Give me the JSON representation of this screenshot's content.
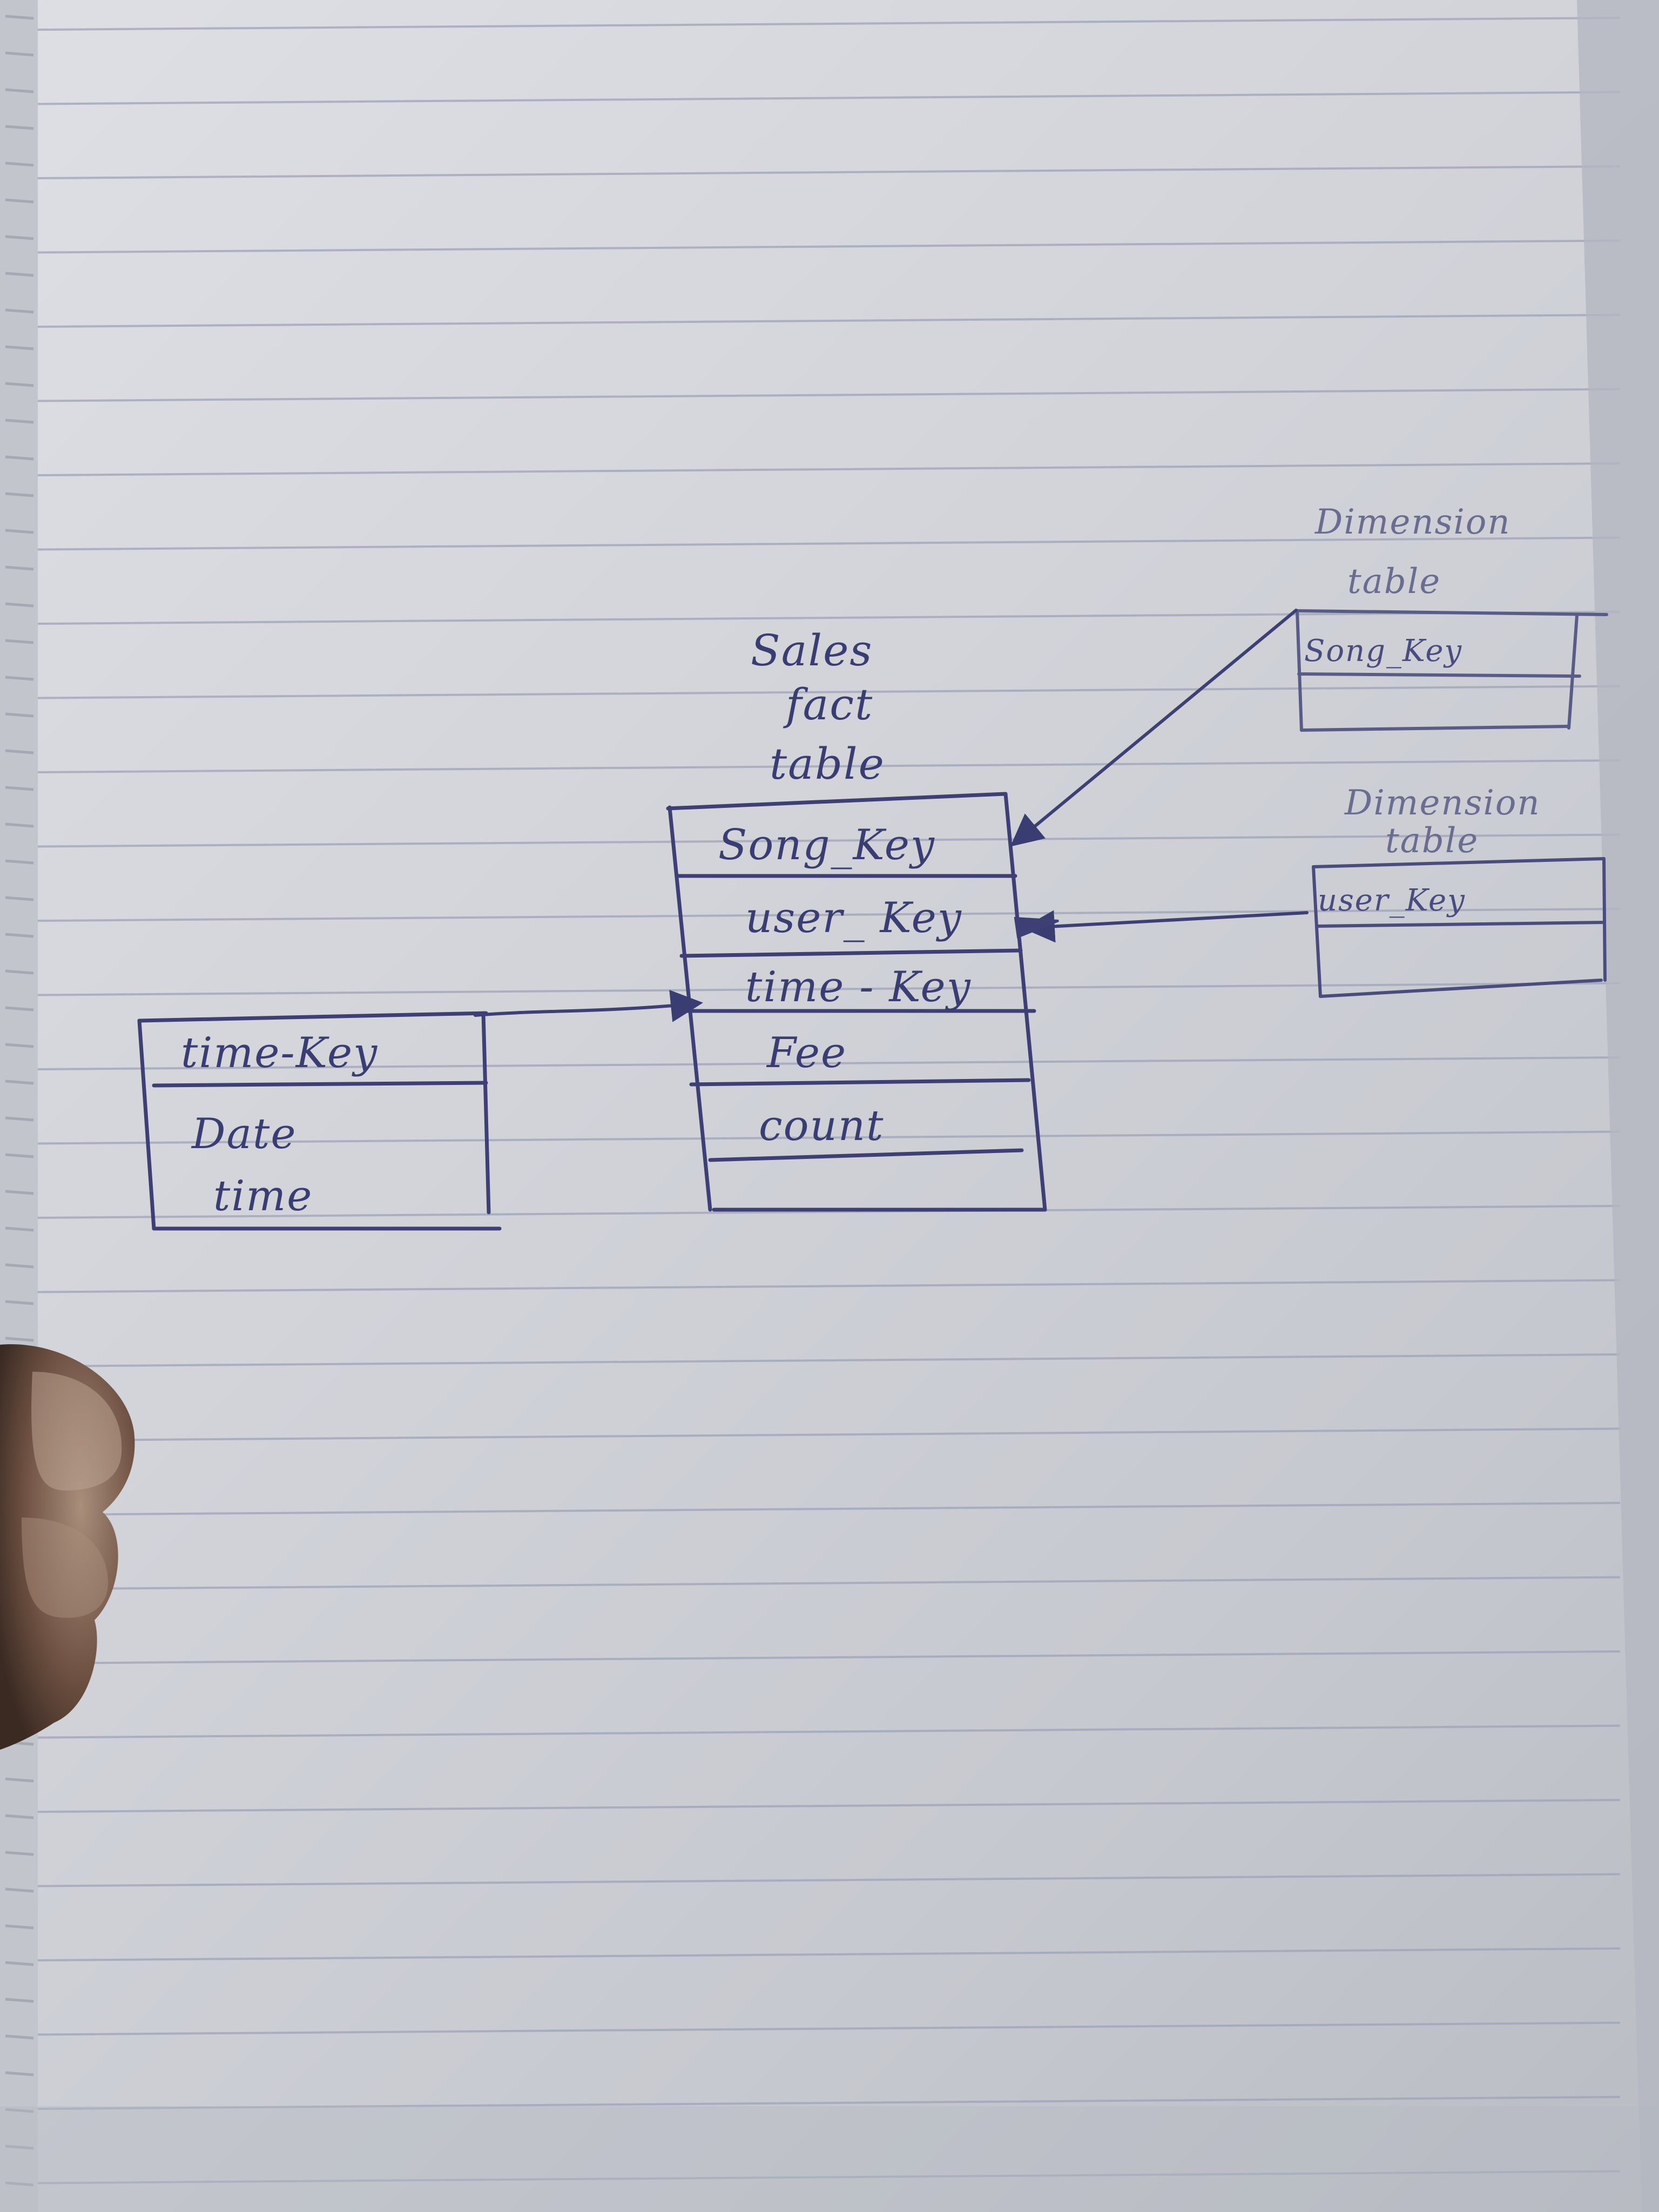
{
  "fact_table": {
    "title_lines": [
      "Sales",
      "fact",
      "table"
    ],
    "fields": [
      "Song_Key",
      "user_ Key",
      "time - Key",
      "Fee",
      "count"
    ]
  },
  "time_table": {
    "fields": [
      "time-Key",
      "Date",
      "time"
    ]
  },
  "dimension_song": {
    "title_lines": [
      "Dimension",
      "table"
    ],
    "fields": [
      "Song_Key"
    ]
  },
  "dimension_user": {
    "title_lines": [
      "Dimension",
      "table"
    ],
    "fields": [
      "user_Key"
    ]
  },
  "colors": {
    "ink": "#3a3d72",
    "paper": "#d8dadf",
    "rule_line": "#9aa0b6"
  }
}
